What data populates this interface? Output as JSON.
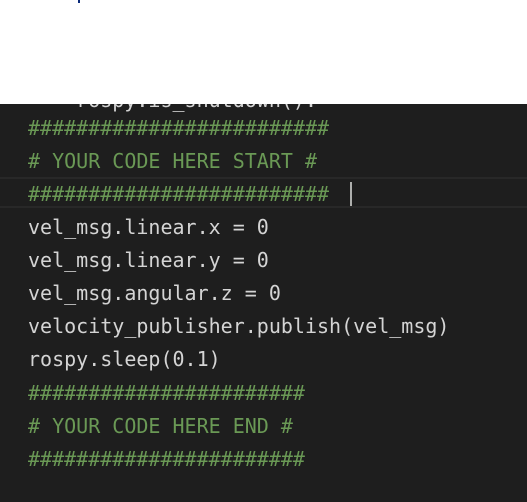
{
  "editor": {
    "partial_line": "    rospy.is_shutdown():",
    "lines": [
      "#########################",
      "# YOUR CODE HERE START #",
      "#########################",
      "vel_msg.linear.x = 0",
      "vel_msg.linear.y = 0",
      "vel_msg.angular.z = 0",
      "velocity_publisher.publish(vel_msg)",
      "rospy.sleep(0.1)",
      "#######################",
      "# YOUR CODE HERE END #",
      "#######################"
    ]
  },
  "colors": {
    "background": "#1e1e1e",
    "code_text": "#d4d4d4",
    "comment_text": "#6a9955"
  }
}
